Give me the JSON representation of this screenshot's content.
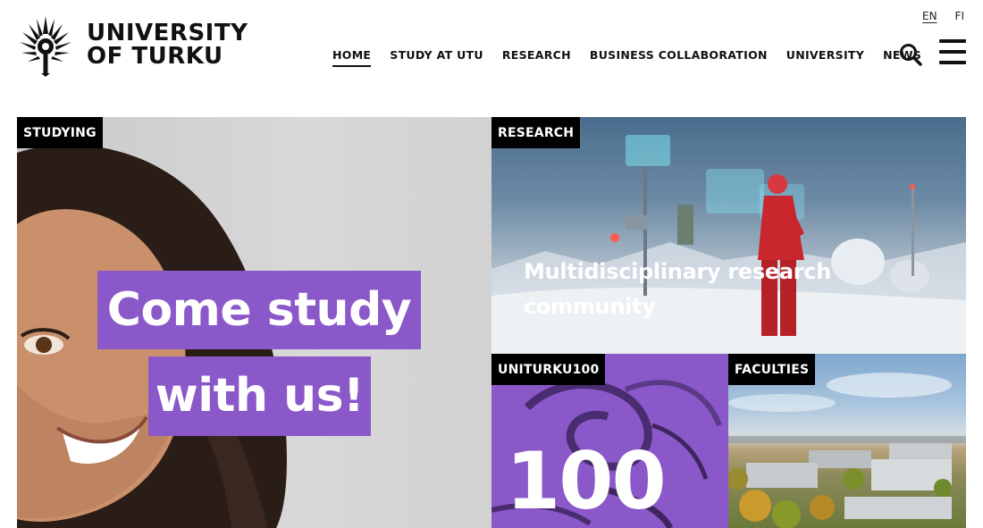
{
  "header": {
    "logo": {
      "line1": "UNIVERSITY",
      "line2": "OF TURKU"
    },
    "languages": [
      {
        "label": "EN",
        "active": true
      },
      {
        "label": "FI",
        "active": false
      }
    ],
    "nav": [
      {
        "label": "HOME",
        "active": true
      },
      {
        "label": "STUDY AT UTU",
        "active": false
      },
      {
        "label": "RESEARCH",
        "active": false
      },
      {
        "label": "BUSINESS COLLABORATION",
        "active": false
      },
      {
        "label": "UNIVERSITY",
        "active": false
      },
      {
        "label": "NEWS",
        "active": false
      }
    ],
    "icons": {
      "search": "search-icon",
      "menu": "hamburger-menu-icon"
    }
  },
  "tiles": {
    "studying": {
      "tag": "STUDYING",
      "line1": "Come study",
      "line2": "with us!"
    },
    "research": {
      "tag": "RESEARCH",
      "title": "Multidisciplinary research community"
    },
    "uniturku100": {
      "tag": "UNITURKU100",
      "number": "100"
    },
    "faculties": {
      "tag": "FACULTIES"
    }
  },
  "colors": {
    "accent_purple": "#8a58c9",
    "tag_background": "#000000",
    "text": "#111111"
  }
}
